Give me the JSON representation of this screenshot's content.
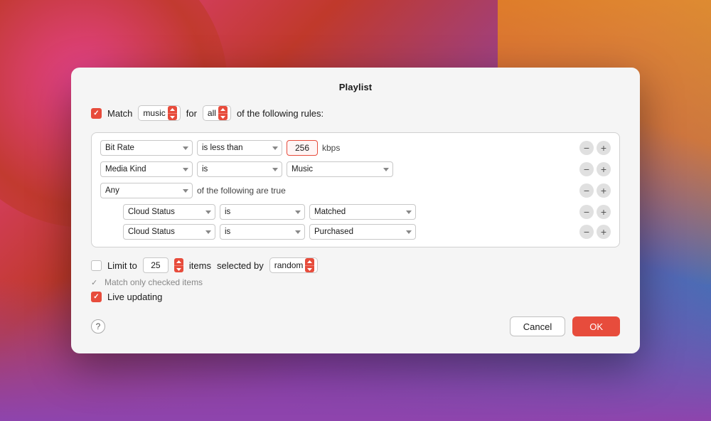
{
  "dialog": {
    "title": "Playlist",
    "match_label": "Match",
    "for_label": "for",
    "of_rules_label": "of the following rules:",
    "music_value": "music",
    "all_value": "all",
    "match_checked": true,
    "rules": [
      {
        "field": "Bit Rate",
        "operator": "is less than",
        "value_type": "number",
        "value": "256",
        "unit": "kbps"
      },
      {
        "field": "Media Kind",
        "operator": "is",
        "value_type": "select",
        "value": "Music"
      },
      {
        "field": "Any",
        "operator": "of the following are true",
        "value_type": "group",
        "sub_rules": [
          {
            "field": "Cloud Status",
            "operator": "is",
            "value": "Matched"
          },
          {
            "field": "Cloud Status",
            "operator": "is",
            "value": "Purchased"
          }
        ]
      }
    ],
    "limit_section": {
      "limit_to_label": "Limit to",
      "limit_value": "25",
      "items_label": "items",
      "selected_by_label": "selected by",
      "random_value": "random",
      "limit_checked": false
    },
    "match_checked_items_label": "Match only checked items",
    "live_updating_label": "Live updating",
    "live_updating_checked": true,
    "cancel_label": "Cancel",
    "ok_label": "OK",
    "help_label": "?"
  }
}
